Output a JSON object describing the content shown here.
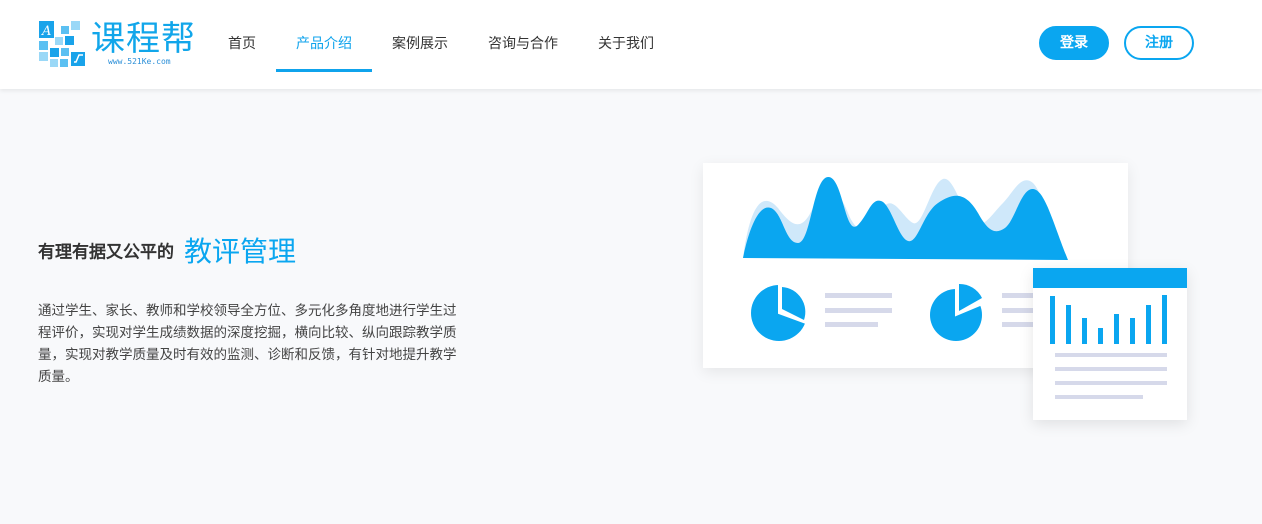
{
  "logo": {
    "brand": "课程帮",
    "url": "www.521Ke.com"
  },
  "nav": {
    "items": [
      {
        "label": "首页"
      },
      {
        "label": "产品介绍"
      },
      {
        "label": "案例展示"
      },
      {
        "label": "咨询与合作"
      },
      {
        "label": "关于我们"
      }
    ],
    "active_index": 1
  },
  "auth": {
    "login": "登录",
    "register": "注册"
  },
  "hero": {
    "prefix": "有理有据又公平的",
    "highlight": "教评管理",
    "description": "通过学生、家长、教师和学校领导全方位、多元化多角度地进行学生过程评价，实现对学生成绩数据的深度挖掘，横向比较、纵向跟踪教学质量，实现对教学质量及时有效的监测、诊断和反馈，有针对地提升教学质量。"
  },
  "colors": {
    "accent": "#0aa6f0",
    "accent_light": "#cfe8fa",
    "line_gray": "#d6d9ea"
  },
  "icons": [
    "logo-mark-icon",
    "area-chart-illustration",
    "pie-chart-icon",
    "bar-chart-illustration"
  ]
}
